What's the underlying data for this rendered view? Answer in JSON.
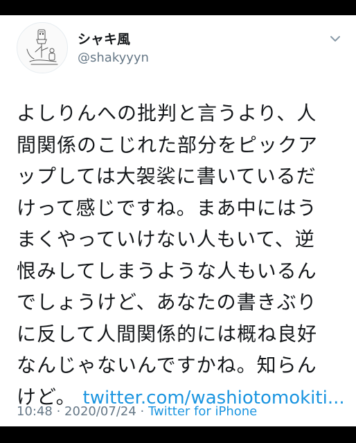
{
  "user": {
    "display_name": "シャキ風",
    "handle": "@shakyyyn",
    "avatar_icon": "sketch-avatar"
  },
  "more_icon": "chevron-down-icon",
  "tweet": {
    "lines": [
      "よしりんへの批判と言うより、人",
      "間関係のこじれた部分をピックア",
      "ップしては大袈裟に書いているだ",
      "けって感じですね。まあ中にはう",
      "まくやっていけない人もいて、逆",
      "恨みしてしまうような人もいるん",
      "でしょうけど、あなたの書きぶり",
      "に反して人間関係的には概ね良好",
      "なんじゃないんですかね。知らん"
    ],
    "last_line_prefix": "けど。",
    "link_text": "twitter.com/washiotomokiti..."
  },
  "meta": {
    "time": "10:48",
    "separator1": " · ",
    "date": "2020/07/24",
    "separator2": " · ",
    "source": "Twitter for iPhone"
  },
  "colors": {
    "text": "#14171a",
    "secondary": "#657786",
    "link": "#1b95e0",
    "background": "#ffffff",
    "frame": "#000000"
  }
}
